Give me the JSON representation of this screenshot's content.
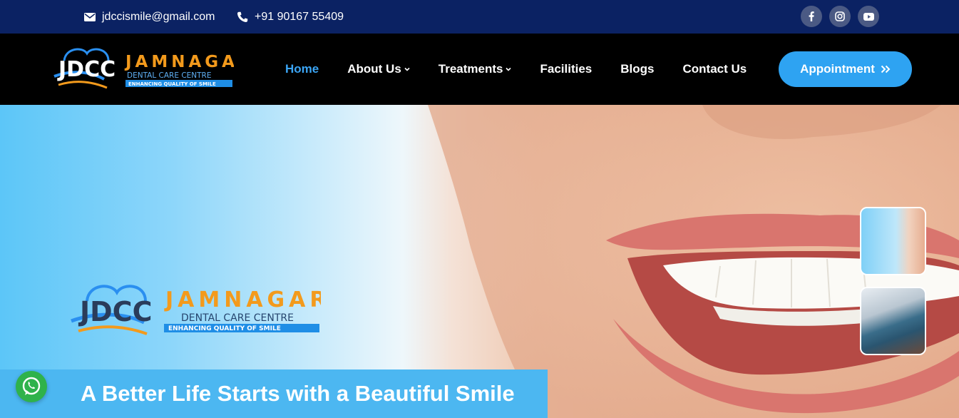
{
  "topbar": {
    "email": "jdccismile@gmail.com",
    "phone": "+91 90167 55409",
    "socials": [
      "facebook-icon",
      "instagram-icon",
      "youtube-icon"
    ]
  },
  "logo": {
    "mark": "JDCC",
    "name": "JAMNAGAR",
    "subtitle": "DENTAL CARE CENTRE",
    "tagline": "ENHANCING QUALITY OF SMILE"
  },
  "nav": {
    "items": [
      {
        "label": "Home",
        "active": true
      },
      {
        "label": "About Us",
        "dropdown": true
      },
      {
        "label": "Treatments",
        "dropdown": true
      },
      {
        "label": "Facilities"
      },
      {
        "label": "Blogs"
      },
      {
        "label": "Contact Us"
      }
    ],
    "cta": "Appointment"
  },
  "hero": {
    "tagline": "A Better Life Starts with a Beautiful Smile"
  },
  "colors": {
    "topbar": "#0b2263",
    "navbar": "#000000",
    "accent": "#2ea3f2",
    "active_link": "#3ba5f5",
    "tagline_band": "#4cb7f1",
    "whatsapp": "#2fb24b"
  }
}
